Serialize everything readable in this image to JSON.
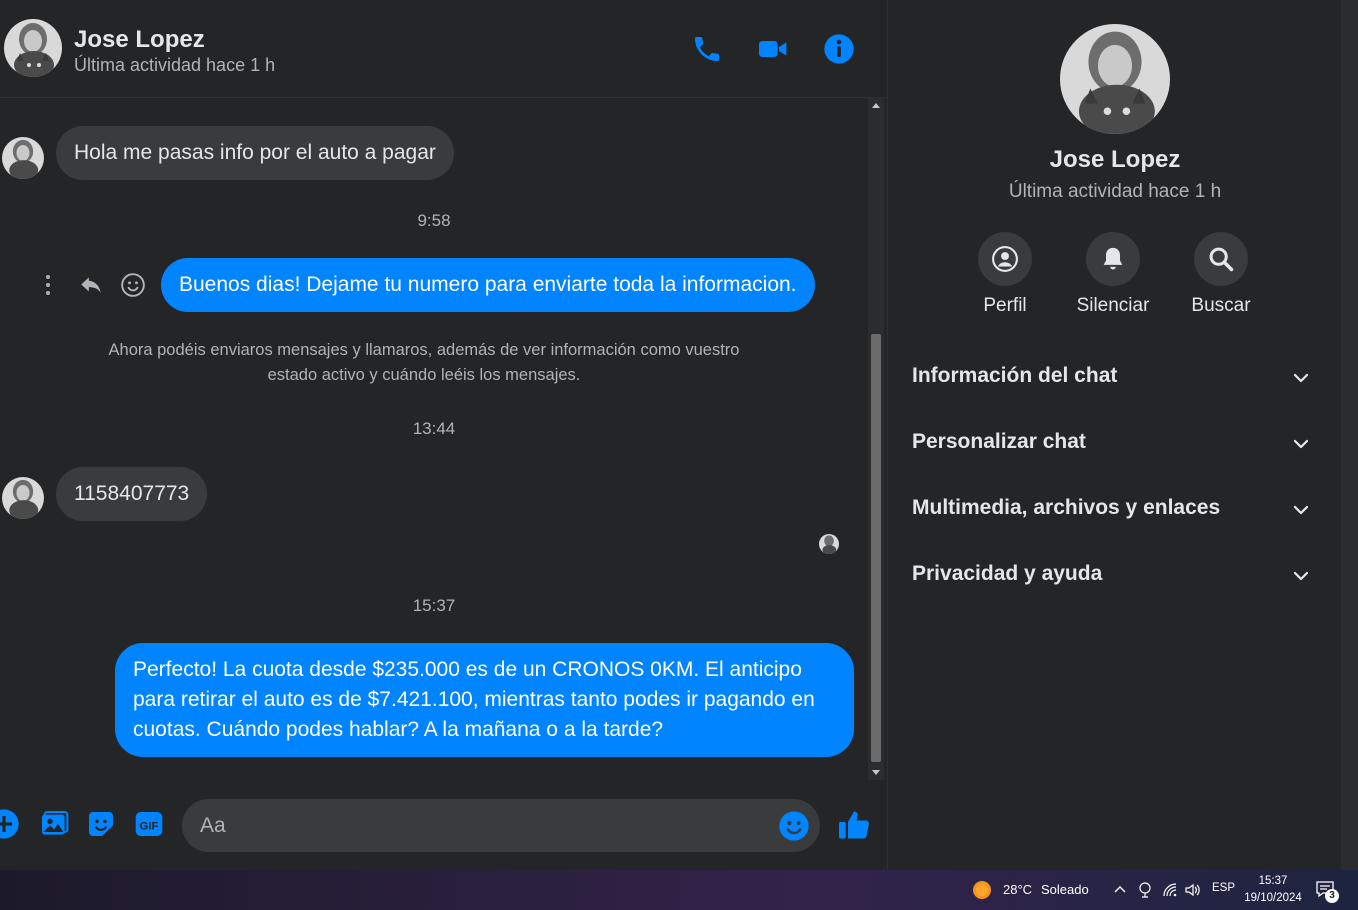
{
  "contact": {
    "name": "Jose Lopez",
    "status": "Última actividad hace 1 h"
  },
  "header_icons": [
    "phone-icon",
    "video-camera-icon",
    "info-icon"
  ],
  "messages": [
    {
      "direction": "in",
      "text": "Hola me pasas info por el auto a pagar"
    },
    {
      "time": "9:58"
    },
    {
      "direction": "out",
      "text": "Buenos dias! Dejame tu numero para enviarte toda la informacion."
    },
    {
      "notice": "Ahora podéis enviaros mensajes y llamaros, además de ver información como vuestro estado activo y cuándo leéis los mensajes."
    },
    {
      "time": "13:44"
    },
    {
      "direction": "in",
      "text": "1158407773"
    },
    {
      "time": "15:37"
    },
    {
      "direction": "out",
      "text": "Perfecto! La cuota desde $235.000 es de un CRONOS 0KM. El anticipo para retirar el auto es de $7.421.100, mientras tanto podes ir pagando en cuotas. Cuándo podes hablar? A la mañana o a la tarde?"
    }
  ],
  "composer": {
    "placeholder": "Aa"
  },
  "panel": {
    "actions": [
      {
        "label": "Perfil",
        "icon": "profile-icon"
      },
      {
        "label": "Silenciar",
        "icon": "bell-icon"
      },
      {
        "label": "Buscar",
        "icon": "search-icon"
      }
    ],
    "sections": [
      {
        "label": "Información del chat"
      },
      {
        "label": "Personalizar chat"
      },
      {
        "label": "Multimedia, archivos y enlaces"
      },
      {
        "label": "Privacidad y ayuda"
      }
    ]
  },
  "taskbar": {
    "weather": "28°C",
    "weather_desc": "Soleado",
    "language": "ESP",
    "time": "15:37",
    "date": "19/10/2024",
    "notifications": "3"
  },
  "colors": {
    "accent": "#0084ff",
    "background": "#242526",
    "incoming_bubble": "#3a3b3c"
  }
}
